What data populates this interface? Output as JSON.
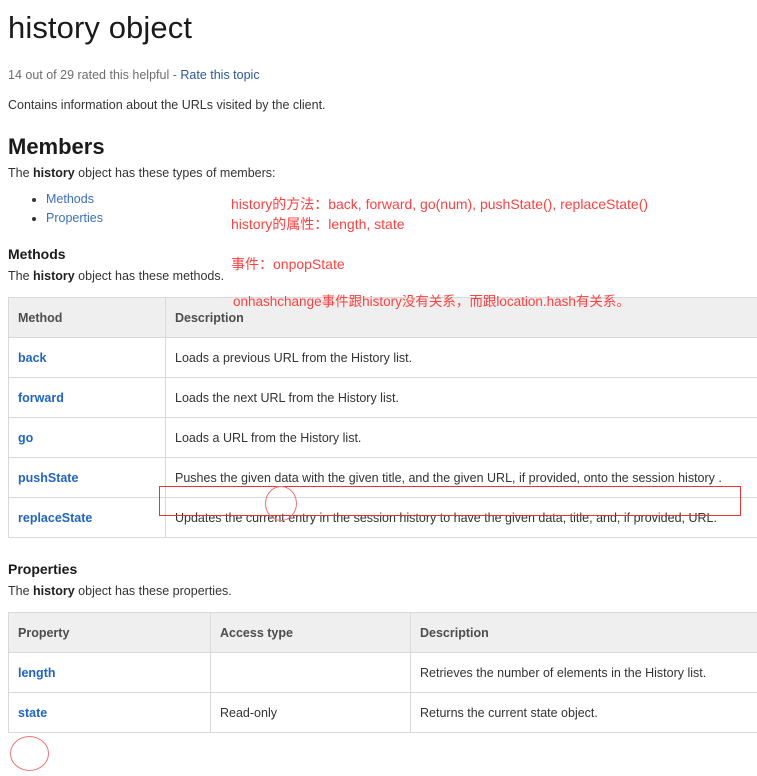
{
  "page": {
    "title": "history object",
    "rating": {
      "text": "14 out of 29 rated this helpful",
      "separator": "-",
      "link_label": "Rate this topic"
    },
    "intro": "Contains information about the URLs visited by the client."
  },
  "members": {
    "heading": "Members",
    "lead_prefix": "The ",
    "lead_bold": "history",
    "lead_suffix": " object has these types of members:",
    "list": [
      {
        "label": "Methods"
      },
      {
        "label": "Properties"
      }
    ]
  },
  "methods_section": {
    "heading": "Methods",
    "lead_prefix": "The ",
    "lead_bold": "history",
    "lead_suffix": " object has these methods.",
    "table": {
      "columns": [
        "Method",
        "Description"
      ],
      "rows": [
        {
          "name": "back",
          "description": "Loads a previous URL from the History list."
        },
        {
          "name": "forward",
          "description": "Loads the next URL from the History list."
        },
        {
          "name": "go",
          "description": "Loads a URL from the History list."
        },
        {
          "name": "pushState",
          "description": "Pushes the given data with the given title, and the given URL, if provided, onto the session history ."
        },
        {
          "name": "replaceState",
          "description": "Updates the current entry in the session history to have the given data, title, and, if provided, URL."
        }
      ]
    }
  },
  "properties_section": {
    "heading": "Properties",
    "lead_prefix": "The ",
    "lead_bold": "history",
    "lead_suffix": " object has these properties.",
    "table": {
      "columns": [
        "Property",
        "Access type",
        "Description"
      ],
      "rows": [
        {
          "name": "length",
          "access": "",
          "description": "Retrieves the number of elements in the History list."
        },
        {
          "name": "state",
          "access": "Read-only",
          "description": "Returns the current state object."
        }
      ]
    }
  },
  "annotations": {
    "color": "#ff4040",
    "methods_line": "history的方法：back, forward, go(num), pushState(), replaceState()",
    "properties_line": "history的属性：length, state",
    "events_line": "事件：onpopState",
    "onhashchange_line": "onhashchange事件跟history没有关系，而跟location.hash有关系。",
    "highlight_box_target": "pushState description",
    "circle_data_target": "data",
    "circle_state_target": "state"
  }
}
